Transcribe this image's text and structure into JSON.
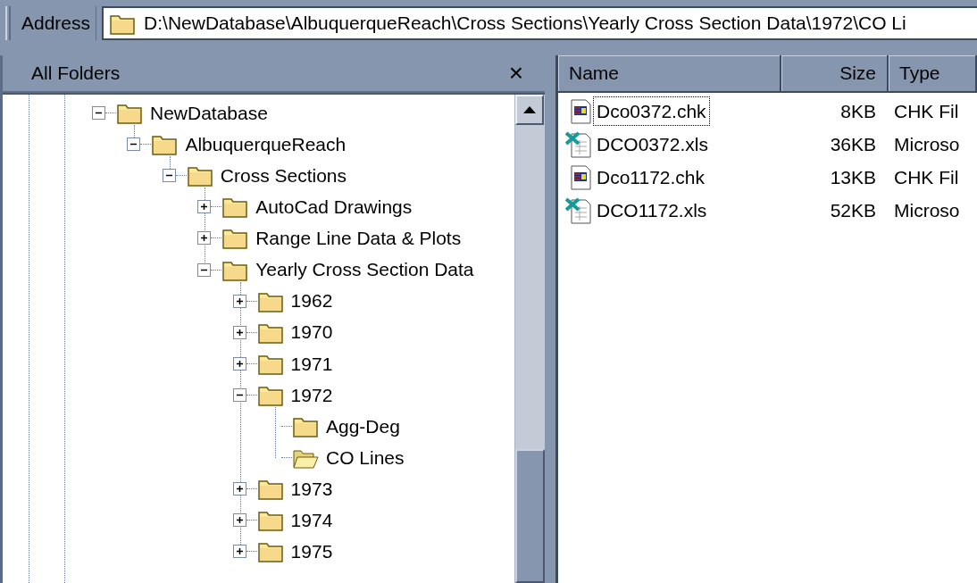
{
  "address_bar": {
    "label": "Address",
    "path": "D:\\NewDatabase\\AlbuquerqueReach\\Cross Sections\\Yearly Cross Section Data\\1972\\CO Li"
  },
  "folder_pane": {
    "title": "All Folders",
    "close": "×"
  },
  "tree": [
    {
      "label": "NewDatabase",
      "expanded": true,
      "selected": false,
      "children": [
        {
          "label": "AlbuquerqueReach",
          "expanded": true,
          "selected": false,
          "children": [
            {
              "label": "Cross Sections",
              "expanded": true,
              "selected": false,
              "children": [
                {
                  "label": "AutoCad Drawings",
                  "expanded": false,
                  "selected": false
                },
                {
                  "label": "Range Line Data & Plots",
                  "expanded": false,
                  "selected": false
                },
                {
                  "label": "Yearly Cross Section Data",
                  "expanded": true,
                  "selected": false,
                  "children": [
                    {
                      "label": "1962",
                      "expanded": false,
                      "selected": false
                    },
                    {
                      "label": "1970",
                      "expanded": false,
                      "selected": false
                    },
                    {
                      "label": "1971",
                      "expanded": false,
                      "selected": false
                    },
                    {
                      "label": "1972",
                      "expanded": true,
                      "selected": false,
                      "children": [
                        {
                          "label": "Agg-Deg",
                          "selected": false
                        },
                        {
                          "label": "CO Lines",
                          "selected": true
                        }
                      ]
                    },
                    {
                      "label": "1973",
                      "expanded": false,
                      "selected": false
                    },
                    {
                      "label": "1974",
                      "expanded": false,
                      "selected": false
                    },
                    {
                      "label": "1975",
                      "expanded": false,
                      "selected": false
                    }
                  ]
                }
              ]
            }
          ]
        }
      ]
    }
  ],
  "file_list": {
    "columns": [
      "Name",
      "Size",
      "Type"
    ],
    "rows": [
      {
        "kind": "chk",
        "name": "Dco0372.chk",
        "size": "8KB",
        "type": "CHK Fil",
        "focused": true
      },
      {
        "kind": "xls",
        "name": "DCO0372.xls",
        "size": "36KB",
        "type": "Microso",
        "focused": false
      },
      {
        "kind": "chk",
        "name": "Dco1172.chk",
        "size": "13KB",
        "type": "CHK Fil",
        "focused": false
      },
      {
        "kind": "xls",
        "name": "DCO1172.xls",
        "size": "52KB",
        "type": "Microso",
        "focused": false
      }
    ]
  }
}
